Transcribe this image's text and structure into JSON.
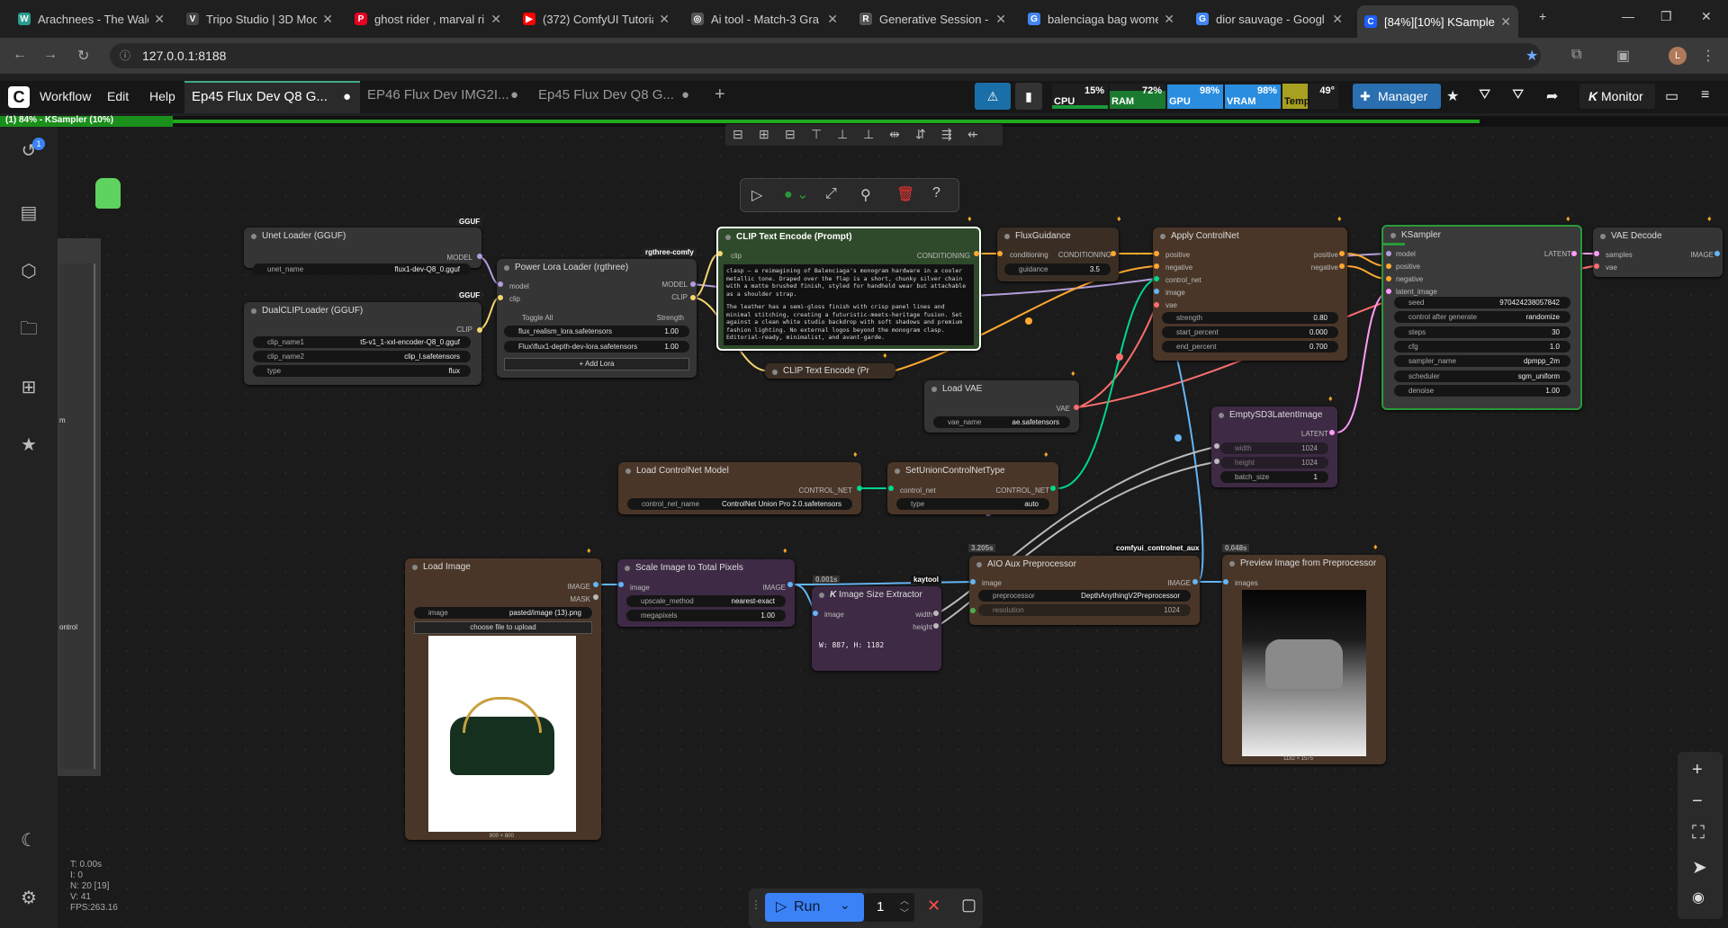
{
  "browser": {
    "tabs": [
      {
        "label": "Arachnees - The Wald",
        "color": "#2a9d8f",
        "glyph": "W"
      },
      {
        "label": "Tripo Studio | 3D Mod",
        "color": "#444",
        "glyph": "V"
      },
      {
        "label": "ghost rider , marval ri",
        "color": "#e60023",
        "glyph": "P"
      },
      {
        "label": "(372) ComfyUI Tutoria",
        "color": "#ff0000",
        "glyph": "▶"
      },
      {
        "label": "Ai tool - Match-3 Gra",
        "color": "#555",
        "glyph": "◎"
      },
      {
        "label": "Generative Session - F",
        "color": "#555",
        "glyph": "R"
      },
      {
        "label": "balenciaga bag wome",
        "color": "#4285f4",
        "glyph": "G"
      },
      {
        "label": "dior sauvage - Googl",
        "color": "#4285f4",
        "glyph": "G"
      },
      {
        "label": "[84%][10%] KSampler",
        "color": "#1e5eff",
        "glyph": "C"
      }
    ],
    "url": "127.0.0.1:8188"
  },
  "menu": {
    "items": [
      "Workflow",
      "Edit",
      "Help"
    ],
    "workflow_tabs": [
      {
        "label": "Ep45 Flux Dev Q8 G...",
        "active": true
      },
      {
        "label": "EP46 Flux Dev IMG2I...",
        "active": false
      },
      {
        "label": "Ep45 Flux Dev Q8 G...",
        "active": false
      }
    ],
    "manager_label": "Manager",
    "monitor_label": "Monitor"
  },
  "meters": {
    "cpu": {
      "label": "CPU",
      "value": "15%",
      "level": 0.15
    },
    "ram": {
      "label": "RAM",
      "value": "72%",
      "level": 0.72
    },
    "gpu": {
      "label": "GPU",
      "value": "98%",
      "level": 0.98
    },
    "vram": {
      "label": "VRAM",
      "value": "98%",
      "level": 0.98
    },
    "temp": {
      "label": "Temp",
      "value": "49°",
      "level": 0.49
    }
  },
  "progress": {
    "text": "(1) 84% - KSampler (10%)",
    "value": 0.84
  },
  "history_badge": "1",
  "group_labels": {
    "a": "m",
    "b": "ontrol"
  },
  "nodes": {
    "unet": {
      "title": "Unet Loader (GGUF)",
      "badge": "GGUF",
      "out": "MODEL",
      "name": "unet_name",
      "value": "flux1-dev-Q8_0.gguf"
    },
    "dualclip": {
      "title": "DualCLIPLoader (GGUF)",
      "badge": "GGUF",
      "out": "CLIP",
      "w1n": "clip_name1",
      "w1v": "t5-v1_1-xxl-encoder-Q8_0.gguf",
      "w2n": "clip_name2",
      "w2v": "clip_l.safetensors",
      "w3n": "type",
      "w3v": "flux"
    },
    "lora": {
      "title": "Power Lora Loader (rgthree)",
      "badge": "rgthree-comfy",
      "in1": "model",
      "in2": "clip",
      "out1": "MODEL",
      "out2": "CLIP",
      "toggle": "Toggle All",
      "strength": "Strength",
      "l1": "flux_realism_lora.safetensors",
      "l1v": "1.00",
      "l2": "Flux\\flux1-depth-dev-lora.safetensors",
      "l2v": "1.00",
      "add": "Add Lora"
    },
    "clip": {
      "title": "CLIP Text Encode (Prompt)",
      "in": "clip",
      "out": "CONDITIONING",
      "text_p1": "clasp — a reimagining of Balenciaga's monogram hardware in a cooler metallic tone. Draped over the flap is a short, chunky silver chain with a matte brushed finish, styled for handheld wear but attachable as a shoulder strap.",
      "text_p2": "The leather has a semi-gloss finish with crisp panel lines and minimal stitching, creating a futuristic-meets-heritage fusion. Set against a clean white studio backdrop with soft shadows and premium fashion lighting. No external logos beyond the monogram clasp. Editorial-ready, minimalist, and avant-garde."
    },
    "clip2": {
      "title": "CLIP Text Encode (Pr"
    },
    "fluxguid": {
      "title": "FluxGuidance",
      "in": "conditioning",
      "out": "CONDITIONING",
      "name": "guidance",
      "value": "3.5"
    },
    "apply": {
      "title": "Apply ControlNet",
      "inputs": [
        "positive",
        "negative",
        "control_net",
        "image",
        "vae"
      ],
      "out1": "positive",
      "out2": "negative",
      "w": [
        {
          "n": "strength",
          "v": "0.80"
        },
        {
          "n": "start_percent",
          "v": "0.000"
        },
        {
          "n": "end_percent",
          "v": "0.700"
        }
      ]
    },
    "ksampler": {
      "title": "KSampler",
      "inputs": [
        "model",
        "positive",
        "negative",
        "latent_image"
      ],
      "out": "LATENT",
      "w": [
        {
          "n": "seed",
          "v": "970424238057842"
        },
        {
          "n": "control after generate",
          "v": "randomize"
        },
        {
          "n": "steps",
          "v": "30"
        },
        {
          "n": "cfg",
          "v": "1.0"
        },
        {
          "n": "sampler_name",
          "v": "dpmpp_2m"
        },
        {
          "n": "scheduler",
          "v": "sgm_uniform"
        },
        {
          "n": "denoise",
          "v": "1.00"
        }
      ]
    },
    "vaedecode": {
      "title": "VAE Decode",
      "in1": "samples",
      "in2": "vae",
      "out": "IMAGE"
    },
    "loadvae": {
      "title": "Load VAE",
      "out": "VAE",
      "name": "vae_name",
      "value": "ae.safetensors"
    },
    "empty": {
      "title": "EmptySD3LatentImage",
      "out": "LATENT",
      "w": [
        {
          "n": "width",
          "v": "1024"
        },
        {
          "n": "height",
          "v": "1024"
        },
        {
          "n": "batch_size",
          "v": "1"
        }
      ]
    },
    "loadcn": {
      "title": "Load ControlNet Model",
      "out": "CONTROL_NET",
      "name": "control_net_name",
      "value": "ControlNet Union Pro 2.0.safetensors"
    },
    "setunion": {
      "title": "SetUnionControlNetType",
      "in": "control_net",
      "out": "CONTROL_NET",
      "name": "type",
      "value": "auto"
    },
    "loadimg": {
      "title": "Load Image",
      "out1": "IMAGE",
      "out2": "MASK",
      "name": "image",
      "value": "pasted/image (13).png",
      "upload": "choose file to upload",
      "dims": "800 × 800"
    },
    "scale": {
      "title": "Scale Image to Total Pixels",
      "in": "image",
      "out": "IMAGE",
      "w": [
        {
          "n": "upscale_method",
          "v": "nearest-exact"
        },
        {
          "n": "megapixels",
          "v": "1.00"
        }
      ]
    },
    "sizeext": {
      "title": "Image Size Extractor",
      "badge": "kaytool",
      "time": "0.001s",
      "in": "image",
      "out1": "width",
      "out2": "height",
      "result": "W: 887, H: 1182"
    },
    "aio": {
      "title": "AIO Aux Preprocessor",
      "badge": "comfyui_controlnet_aux",
      "time": "3.205s",
      "in": "image",
      "out": "IMAGE",
      "w1n": "preprocessor",
      "w1v": "DepthAnythingV2Preprocessor",
      "w2n": "resolution",
      "w2v": "1024"
    },
    "preview": {
      "title": "Preview Image from Preprocessor",
      "time": "0.048s",
      "in": "images",
      "dims": "1182 × 1575"
    }
  },
  "bottom": {
    "run": "Run",
    "count": "1"
  },
  "stats": [
    "T: 0.00s",
    "I: 0",
    "N: 20 [19]",
    "V: 41",
    "FPS:263.16"
  ]
}
